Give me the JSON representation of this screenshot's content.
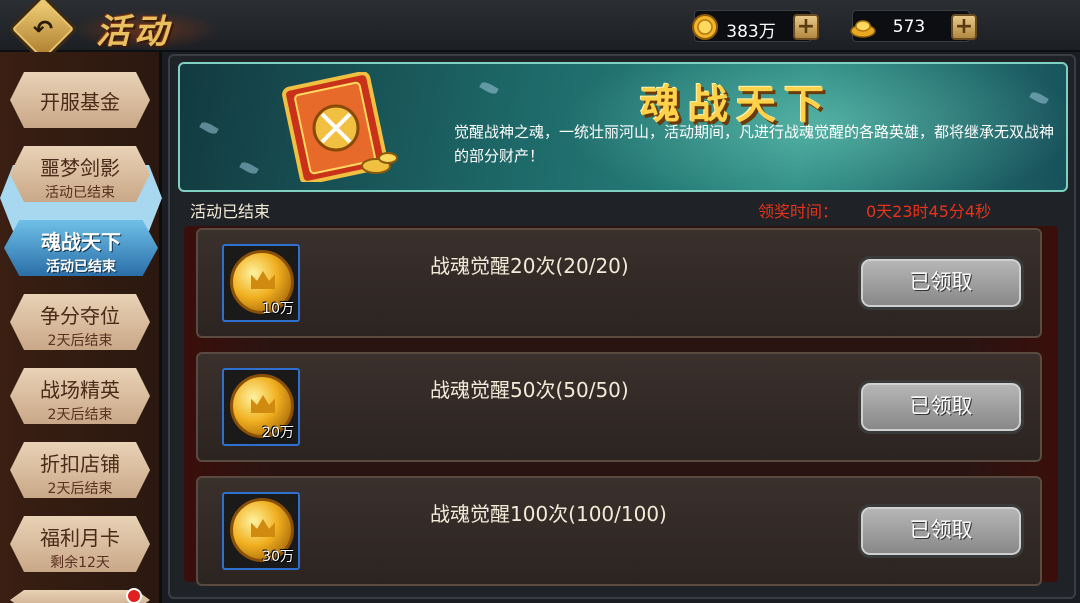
{
  "header": {
    "title": "活动",
    "gold": "383万",
    "ingots": "573",
    "gold_icon": "gold-coin-icon",
    "ingot_icon": "gold-ingot-icon"
  },
  "sidebar": {
    "items": [
      {
        "label": "开服基金",
        "status": ""
      },
      {
        "label": "噩梦剑影",
        "status": "活动已结束"
      },
      {
        "label": "魂战天下",
        "status": "活动已结束",
        "active": true
      },
      {
        "label": "争分夺位",
        "status": "2天后结束"
      },
      {
        "label": "战场精英",
        "status": "2天后结束"
      },
      {
        "label": "折扣店铺",
        "status": "2天后结束"
      },
      {
        "label": "福利月卡",
        "status": "剩余12天"
      },
      {
        "label": "",
        "status": "",
        "partial": true
      }
    ]
  },
  "banner": {
    "title": "魂战天下",
    "description": "觉醒战神之魂，一统壮丽河山，活动期间，凡进行战魂觉醒的各路英雄，都将继承无双战神的部分财产！"
  },
  "status": {
    "activity_status": "活动已结束",
    "claim_time_label": "领奖时间：",
    "claim_time_value": "0天23时45分4秒"
  },
  "tasks": [
    {
      "name": "战魂觉醒20次(20/20)",
      "reward": "10万",
      "button": "已领取"
    },
    {
      "name": "战魂觉醒50次(50/50)",
      "reward": "20万",
      "button": "已领取"
    },
    {
      "name": "战魂觉醒100次(100/100)",
      "reward": "30万",
      "button": "已领取"
    }
  ],
  "colors": {
    "accent_gold": "#e9c060",
    "timer_red": "#e8321c",
    "active_tab": "#2a6fa8"
  }
}
